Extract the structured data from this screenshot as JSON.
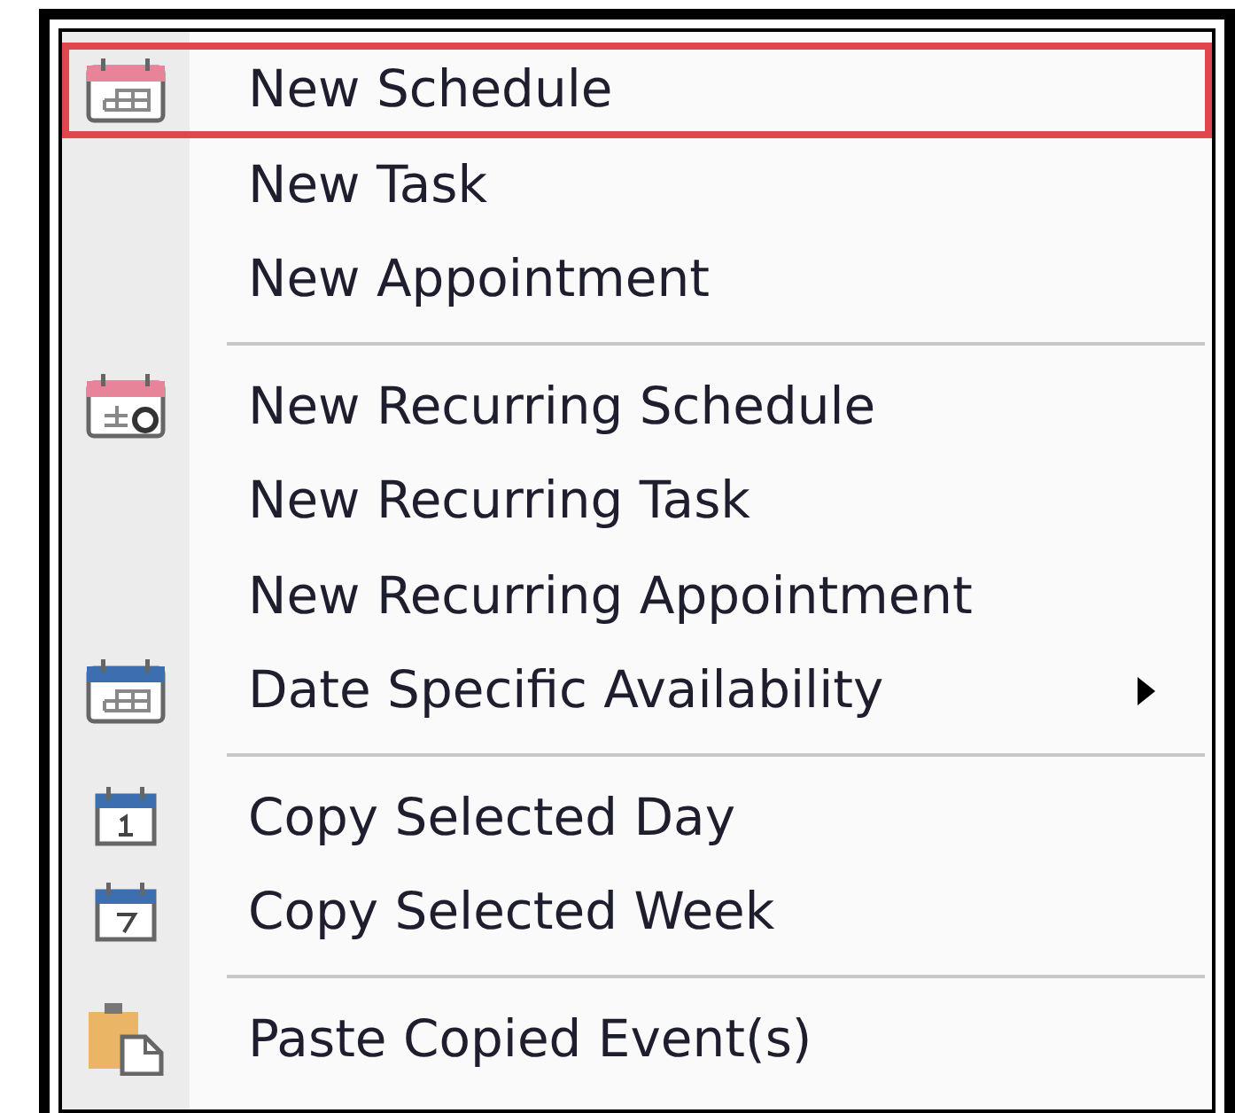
{
  "menu_groups": [
    {
      "items": [
        {
          "label": "New Schedule",
          "kind": "schedule",
          "selected": true,
          "submenu": false
        },
        {
          "label": "New Task",
          "kind": "plain",
          "selected": false,
          "submenu": false
        },
        {
          "label": "New Appointment",
          "kind": "plain",
          "selected": false,
          "submenu": false
        }
      ]
    },
    {
      "items": [
        {
          "label": "New Recurring Schedule",
          "kind": "recurring",
          "selected": false,
          "submenu": false
        },
        {
          "label": "New Recurring Task",
          "kind": "plain",
          "selected": false,
          "submenu": false
        },
        {
          "label": "New Recurring Appointment",
          "kind": "plain",
          "selected": false,
          "submenu": false
        },
        {
          "label": "Date Specific Availability",
          "kind": "availability",
          "selected": false,
          "submenu": true
        }
      ]
    },
    {
      "items": [
        {
          "label": "Copy Selected Day",
          "kind": "day",
          "selected": false,
          "submenu": false
        },
        {
          "label": "Copy Selected Week",
          "kind": "week",
          "selected": false,
          "submenu": false
        }
      ]
    },
    {
      "items": [
        {
          "label": "Paste Copied Event(s)",
          "kind": "paste",
          "selected": false,
          "submenu": false
        }
      ]
    }
  ]
}
